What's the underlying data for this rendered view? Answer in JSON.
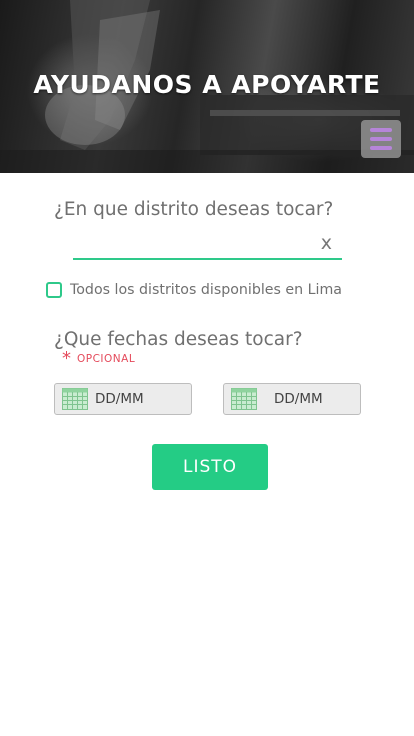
{
  "header": {
    "title": "AYUDANOS A APOYARTE",
    "menu_icon": "hamburger-menu-icon",
    "menu_color": "#b685d9"
  },
  "district": {
    "question": "¿En que distrito deseas tocar?",
    "value": "",
    "placeholder": "",
    "clear_label": "x",
    "underline_color": "#2ec98a"
  },
  "all_districts": {
    "label": "Todos los distritos disponibles en Lima",
    "checked": false
  },
  "dates": {
    "question": "¿Que fechas deseas tocar?",
    "required_mark": "*",
    "optional_label": "OPCIONAL",
    "optional_color": "#e44a5b",
    "calendar_icon": "calendar-icon",
    "start": {
      "label": "DD/MM"
    },
    "end": {
      "label": "DD/MM"
    }
  },
  "submit": {
    "label": "LISTO",
    "color": "#24cc85"
  }
}
